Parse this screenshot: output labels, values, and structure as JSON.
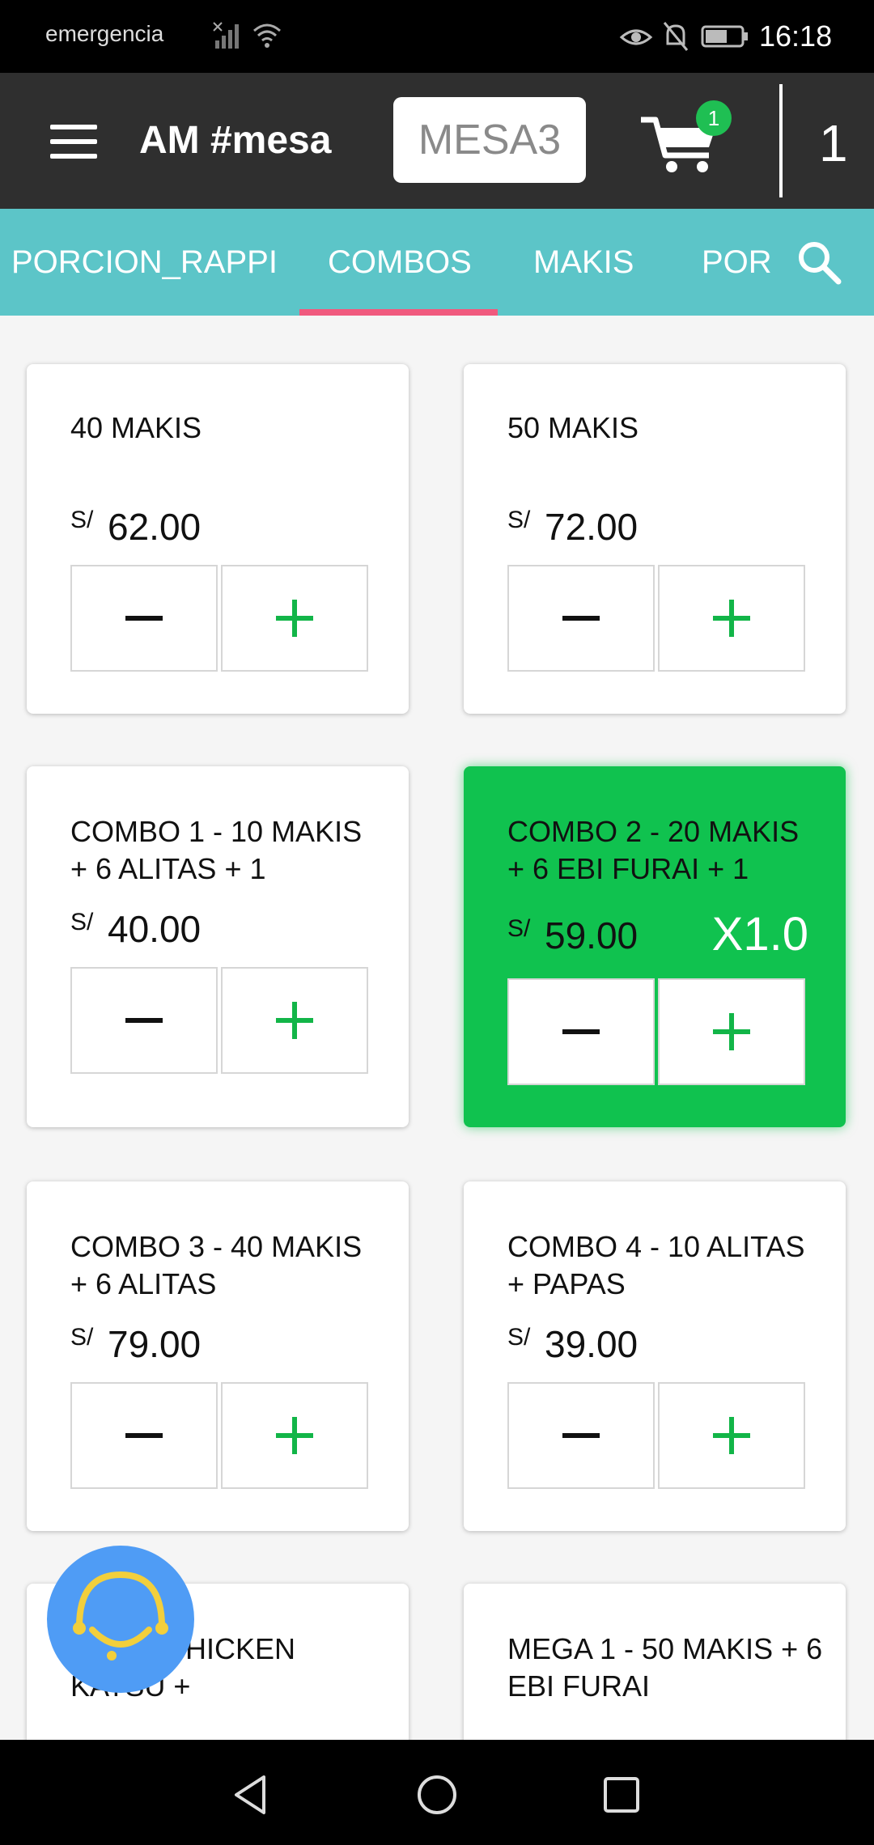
{
  "status_bar": {
    "carrier_text": "emergencia",
    "time": "16:18"
  },
  "header": {
    "title": "AM  #mesa",
    "table": "MESA3",
    "cart_badge": "1",
    "count": "1"
  },
  "tabs": [
    {
      "label": "PORCION_RAPPI"
    },
    {
      "label": "COMBOS",
      "active": true
    },
    {
      "label": "MAKIS"
    },
    {
      "label": "POR"
    }
  ],
  "currency": "S/",
  "products": [
    {
      "name": "40 MAKIS",
      "price": "62.00"
    },
    {
      "name": "50 MAKIS",
      "price": "72.00"
    },
    {
      "name": "COMBO 1 - 10 MAKIS + 6 ALITAS + 1",
      "price": "40.00"
    },
    {
      "name": "COMBO 2 - 20 MAKIS + 6 EBI FURAI + 1",
      "price": "59.00",
      "quantity": "X1.0",
      "selected": true
    },
    {
      "name": "COMBO 3 - 40 MAKIS + 6 ALITAS",
      "price": "79.00"
    },
    {
      "name": "COMBO 4 - 10 ALITAS + PAPAS",
      "price": "39.00"
    },
    {
      "name": "KIDS - CHICKEN KATSU +",
      "price": ""
    },
    {
      "name": "MEGA 1 - 50 MAKIS + 6 EBI FURAI",
      "price": ""
    }
  ],
  "colors": {
    "header_bg": "#2f2f2f",
    "tabs_bg": "#5cc5c8",
    "tab_indicator": "#f05a7e",
    "selected_card": "#10c24f",
    "plus_icon": "#12b548",
    "fab": "#4f9cf5"
  },
  "icons": [
    "menu-icon",
    "cart-icon",
    "search-icon",
    "minus-icon",
    "plus-icon",
    "support-icon",
    "back-icon",
    "home-icon",
    "recents-icon"
  ]
}
